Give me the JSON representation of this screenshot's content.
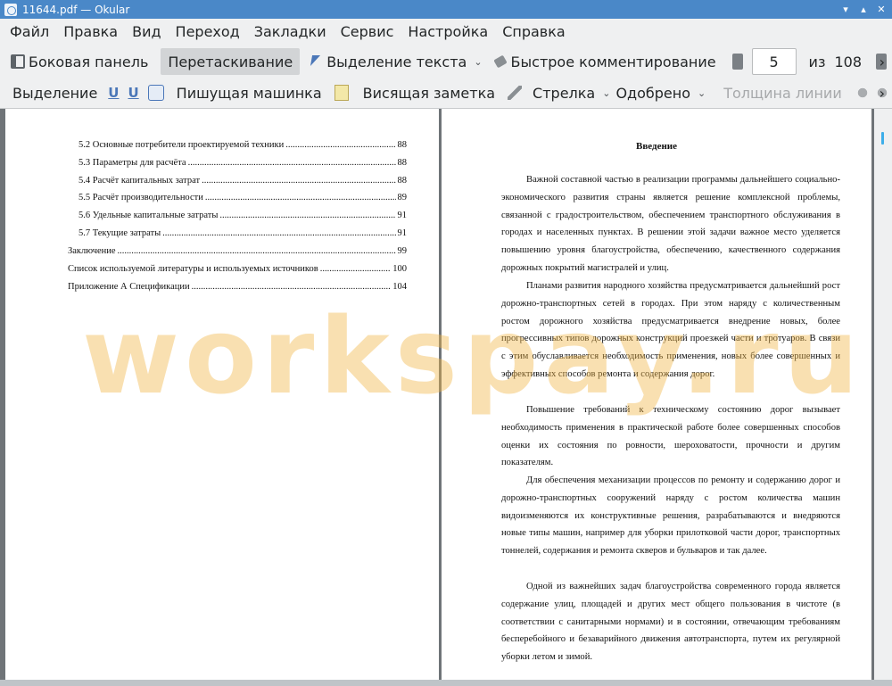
{
  "window": {
    "title": "11644.pdf — Okular"
  },
  "menu": [
    "Файл",
    "Правка",
    "Вид",
    "Переход",
    "Закладки",
    "Сервис",
    "Настройка",
    "Справка"
  ],
  "toolbar1": {
    "sidebar_label": "Боковая панель",
    "browse_label": "Перетаскивание",
    "text_select_label": "Выделение текста",
    "quick_comment_label": "Быстрое комментирование",
    "page_current": "5",
    "page_of": "из",
    "page_total": "108"
  },
  "toolbar2": {
    "highlight_label": "Выделение",
    "typewriter_label": "Пишущая машинка",
    "popup_note_label": "Висящая заметка",
    "arrow_label": "Стрелка",
    "stamp_label": "Одобрено",
    "line_width_label": "Толщина линии"
  },
  "left_page": {
    "toc": [
      {
        "text": "5.2 Основные потребители проектируемой техники",
        "page": "88"
      },
      {
        "text": "5.3 Параметры для расчёта",
        "page": "88"
      },
      {
        "text": "5.4 Расчёт капитальных затрат",
        "page": "88"
      },
      {
        "text": "5.5 Расчёт производительности",
        "page": "89"
      },
      {
        "text": "5.6 Удельные капитальные затраты",
        "page": "91"
      },
      {
        "text": "5.7 Текущие затраты",
        "page": "91"
      },
      {
        "text": "Заключение",
        "page": "99"
      },
      {
        "text": "Список используемой литературы и используемых источников",
        "page": "100"
      },
      {
        "text": "Приложение А Спецификации",
        "page": "104"
      }
    ]
  },
  "right_page": {
    "heading": "Введение",
    "paragraphs": [
      "Важной составной частью в реализации программы дальнейшего социально-экономического развития страны является решение комплексной проблемы, связанной с градостроительством, обеспечением транспортного обслуживания в городах и населенных пунктах. В решении этой задачи важное место уделяется повышению уровня благоустройства, обеспечению, качественного содержания дорожных покрытий магистралей и улиц.",
      "Планами развития народного хозяйства предусматривается дальнейший рост дорожно-транспортных сетей в городах. При этом наряду с количественным ростом дорожного хозяйства предусматривается внедрение новых, более прогрессивных типов дорожных конструкций проезжей части и тротуаров. В связи с этим обуславливается необходимость применения, новых более совершенных и эффективных способов ремонта и содержания дорог.",
      "Повышение требований к техническому состоянию дорог вызывает необходимость применения в практической работе более совершенных способов оценки их состояния по ровности, шероховатости, прочности и другим показателям.",
      "Для обеспечения механизации процессов по ремонту и содержанию дорог и дорожно-транспортных сооружений наряду с ростом количества машин видоизменяются их конструктивные решения, разрабатываются и внедряются новые типы машин, например для уборки прилотковой части дорог, транспортных тоннелей, содержания и ремонта скверов и бульваров и так далее.",
      "Одной из важнейших задач благоустройства современного города является содержание улиц, площадей и других мест общего пользования в чистоте (в соответствии с санитарными нормами) и в состоянии, отвечающим требованиям бесперебойного и безаварийного движения автотранспорта, путем их регулярной уборки летом и зимой."
    ]
  },
  "watermark": "workspay.ru",
  "colors": {
    "titlebar": "#4a88c8",
    "chrome": "#eff0f1",
    "watermark": "#f0b446"
  }
}
